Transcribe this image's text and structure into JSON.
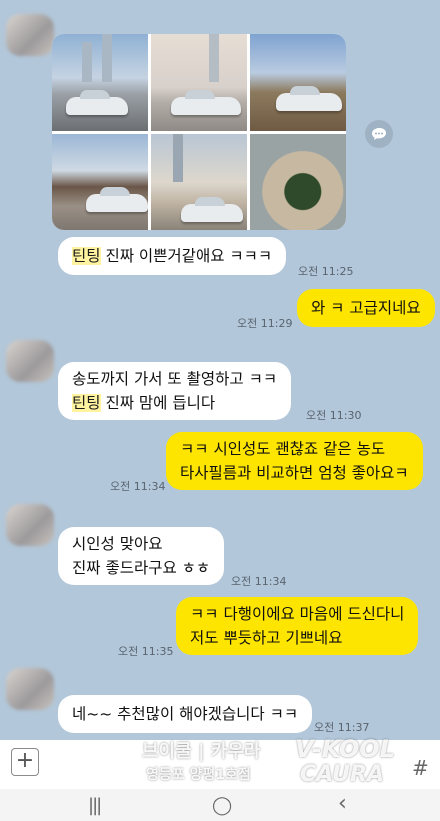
{
  "colors": {
    "chat_bg": "#b2c7d9",
    "outgoing": "#fee500",
    "incoming": "#ffffff",
    "highlight": "#fff3a0"
  },
  "messages": [
    {
      "side": "in",
      "text_hl": "틴팅",
      "text": " 진짜 이쁜거같애요 ㅋㅋㅋ",
      "time": "오전 11:25"
    },
    {
      "side": "out",
      "text": "와 ㅋ 고급지네요",
      "time": "오전 11:29"
    },
    {
      "side": "in",
      "line1": "송도까지 가서 또 촬영하고 ㅋㅋ",
      "line2_hl": "틴팅",
      "line2": " 진짜 맘에 듭니다",
      "time": "오전 11:30"
    },
    {
      "side": "out",
      "line1": "ㅋㅋ 시인성도 괜찮죠 같은 농도",
      "line2": "타사필름과 비교하면 엄청 좋아요ㅋ",
      "time": "오전 11:34"
    },
    {
      "side": "in",
      "line1": "시인성 맞아요",
      "line2": "진짜 좋드라구요 ㅎㅎ",
      "time": "오전 11:34"
    },
    {
      "side": "out",
      "line1": "ㅋㅋ 다행이에요 마음에 드신다니",
      "line2": "저도 뿌듯하고 기쁘네요",
      "time": "오전 11:35"
    },
    {
      "side": "in",
      "text": "네~~ 추천많이 해야겠습니다 ㅋㅋ",
      "time": "오전 11:37"
    }
  ],
  "input": {
    "plus": "+"
  },
  "watermark": {
    "line1": "브이쿨 | 카우라",
    "line2": "영등포 양평1호점",
    "brand1": "V-KOOL",
    "brand2": "CAURA",
    "hash": "#"
  },
  "navbar": {
    "recent": "|||",
    "home": "◯",
    "back": "‹"
  },
  "icons": {
    "share": "share-icon",
    "plus": "plus-icon"
  }
}
